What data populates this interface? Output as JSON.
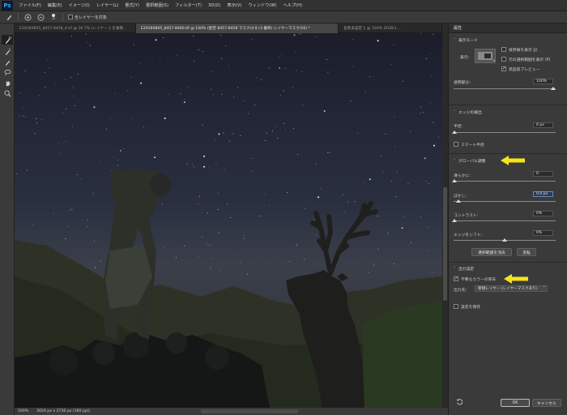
{
  "app": {
    "logo": "Ps",
    "menu": [
      "ファイル(F)",
      "編集(E)",
      "イメージ(I)",
      "レイヤー(L)",
      "書式(Y)",
      "選択範囲(S)",
      "フィルター(T)",
      "3D(D)",
      "表示(V)",
      "ウィンドウ(W)",
      "ヘルプ(H)"
    ]
  },
  "options": {
    "brush_size": "10",
    "sample_all_layers": "全レイヤーを対象"
  },
  "tabs": [
    {
      "label": "E29180805_8457-8458_4.tif @ 16.7% (レイヤー 2 を複製...",
      "active": false
    },
    {
      "label": "E29180805_8457-8460.tif @ 100% (星空  8457-8458  マスク(4 8 (3 番目)  レイヤーマスク/16) *",
      "active": true
    },
    {
      "label": "名称未設定 1 @ 100% (RGB/1...",
      "active": false
    }
  ],
  "status": {
    "zoom": "100%",
    "doc": "3024 px x 2736 px (180 ppi)"
  },
  "panel": {
    "title": "属性",
    "view_mode": {
      "header": "表示モード",
      "view_label": "表示：",
      "show_edge": "境界線を表示 (J)",
      "show_original": "元の選択範囲を表示 (P)",
      "high_quality": "高品質プレビュー"
    },
    "transparency": {
      "label": "透明部分：",
      "value": "100%"
    },
    "edge_detection": {
      "header": "エッジの検出",
      "radius_label": "半径：",
      "radius_value": "0 px",
      "smart_radius": "スマート半径"
    },
    "global_refine": {
      "header": "グローバル調整",
      "smooth_label": "滑らかに：",
      "smooth_value": "0",
      "feather_label": "ぼかし：",
      "feather_value": "0.0 px",
      "contrast_label": "コントラスト：",
      "contrast_value": "0%",
      "shift_label": "エッジをシフト：",
      "shift_value": "0%",
      "clear_button": "選択範囲を消去",
      "invert_button": "反転"
    },
    "output": {
      "header": "出力設定",
      "decontaminate": "不要なカラーの除去",
      "output_to_label": "出力先：",
      "output_to_value": "新規レイヤー (レイヤーマスクあり)",
      "remember": "設定を保存"
    },
    "ok_button": "OK",
    "cancel_button": "キャンセル"
  },
  "colors": {
    "arrow": "#f5e31c",
    "accent": "#31a8ff"
  }
}
